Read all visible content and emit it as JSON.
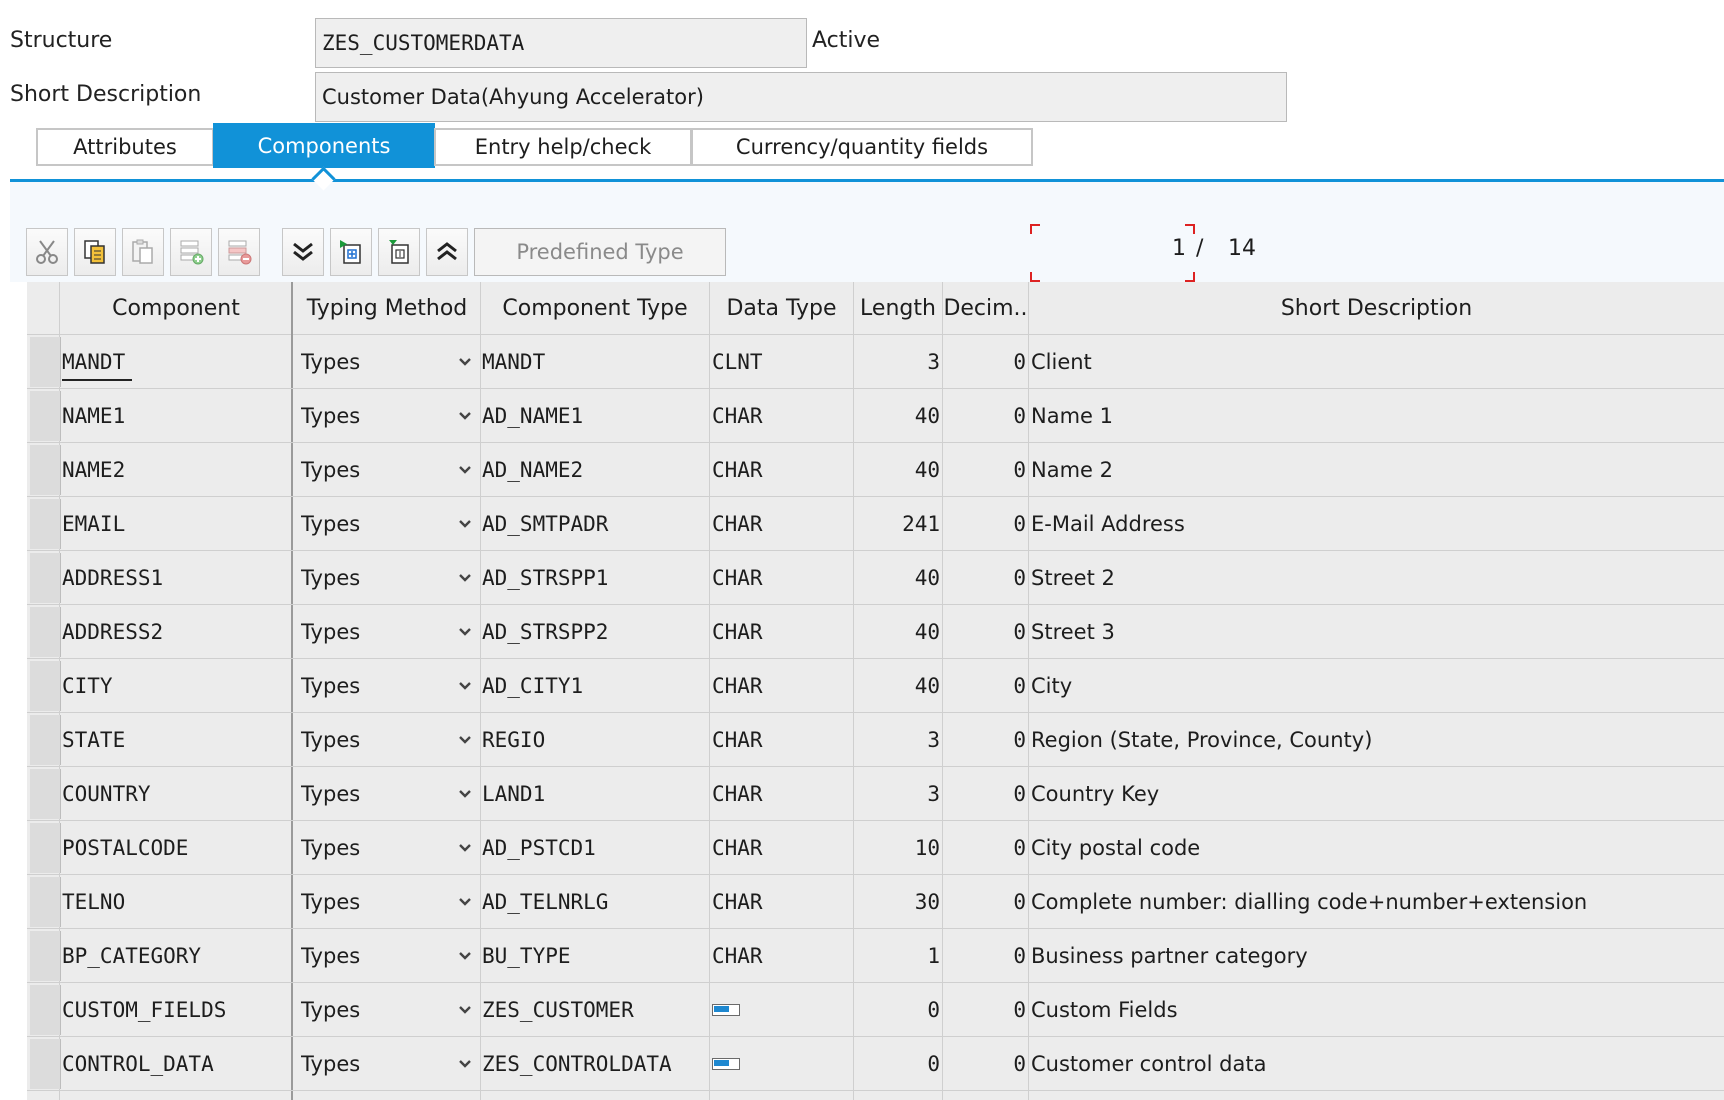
{
  "header": {
    "structure_label": "Structure",
    "structure_value": "ZES_CUSTOMERDATA",
    "status": "Active",
    "short_desc_label": "Short Description",
    "short_desc_value": "Customer Data(Ahyung Accelerator)"
  },
  "tabs": [
    {
      "label": "Attributes",
      "active": false
    },
    {
      "label": "Components",
      "active": true
    },
    {
      "label": "Entry help/check",
      "active": false
    },
    {
      "label": "Currency/quantity fields",
      "active": false
    }
  ],
  "toolbar": {
    "icons": [
      "cut-icon",
      "copy-icon",
      "paste-icon",
      "insert-row-icon",
      "delete-row-icon",
      "expand-all-icon",
      "insert-component-icon",
      "append-component-icon",
      "collapse-all-icon"
    ],
    "predefined_type_label": "Predefined Type",
    "pager_current": "1",
    "pager_sep": "/",
    "pager_total": "14"
  },
  "table": {
    "columns": [
      "Component",
      "Typing Method",
      "Component Type",
      "Data Type",
      "Length",
      "Decim..",
      "Short Description"
    ],
    "rows": [
      {
        "component": "MANDT",
        "typing": "Types",
        "ctype": "MANDT",
        "dtype": "CLNT",
        "length": "3",
        "decimals": "0",
        "desc": "Client"
      },
      {
        "component": "NAME1",
        "typing": "Types",
        "ctype": "AD_NAME1",
        "dtype": "CHAR",
        "length": "40",
        "decimals": "0",
        "desc": "Name 1"
      },
      {
        "component": "NAME2",
        "typing": "Types",
        "ctype": "AD_NAME2",
        "dtype": "CHAR",
        "length": "40",
        "decimals": "0",
        "desc": "Name 2"
      },
      {
        "component": "EMAIL",
        "typing": "Types",
        "ctype": "AD_SMTPADR",
        "dtype": "CHAR",
        "length": "241",
        "decimals": "0",
        "desc": "E-Mail Address"
      },
      {
        "component": "ADDRESS1",
        "typing": "Types",
        "ctype": "AD_STRSPP1",
        "dtype": "CHAR",
        "length": "40",
        "decimals": "0",
        "desc": "Street 2"
      },
      {
        "component": "ADDRESS2",
        "typing": "Types",
        "ctype": "AD_STRSPP2",
        "dtype": "CHAR",
        "length": "40",
        "decimals": "0",
        "desc": "Street 3"
      },
      {
        "component": "CITY",
        "typing": "Types",
        "ctype": "AD_CITY1",
        "dtype": "CHAR",
        "length": "40",
        "decimals": "0",
        "desc": "City"
      },
      {
        "component": "STATE",
        "typing": "Types",
        "ctype": "REGIO",
        "dtype": "CHAR",
        "length": "3",
        "decimals": "0",
        "desc": "Region (State, Province, County)"
      },
      {
        "component": "COUNTRY",
        "typing": "Types",
        "ctype": "LAND1",
        "dtype": "CHAR",
        "length": "3",
        "decimals": "0",
        "desc": "Country Key"
      },
      {
        "component": "POSTALCODE",
        "typing": "Types",
        "ctype": "AD_PSTCD1",
        "dtype": "CHAR",
        "length": "10",
        "decimals": "0",
        "desc": "City postal code"
      },
      {
        "component": "TELNO",
        "typing": "Types",
        "ctype": "AD_TELNRLG",
        "dtype": "CHAR",
        "length": "30",
        "decimals": "0",
        "desc": "Complete number: dialling code+number+extension"
      },
      {
        "component": "BP_CATEGORY",
        "typing": "Types",
        "ctype": "BU_TYPE",
        "dtype": "CHAR",
        "length": "1",
        "decimals": "0",
        "desc": "Business partner category"
      },
      {
        "component": "CUSTOM_FIELDS",
        "typing": "Types",
        "ctype": "ZES_CUSTOMER",
        "dtype": "",
        "dtype_icon": "structure-icon",
        "length": "0",
        "decimals": "0",
        "desc": "Custom Fields"
      },
      {
        "component": "CONTROL_DATA",
        "typing": "Types",
        "ctype": "ZES_CONTROLDATA",
        "dtype": "",
        "dtype_icon": "structure-icon",
        "length": "0",
        "decimals": "0",
        "desc": "Customer control data"
      }
    ]
  },
  "colors": {
    "accent": "#1192d8",
    "table_bg": "#ececec"
  }
}
